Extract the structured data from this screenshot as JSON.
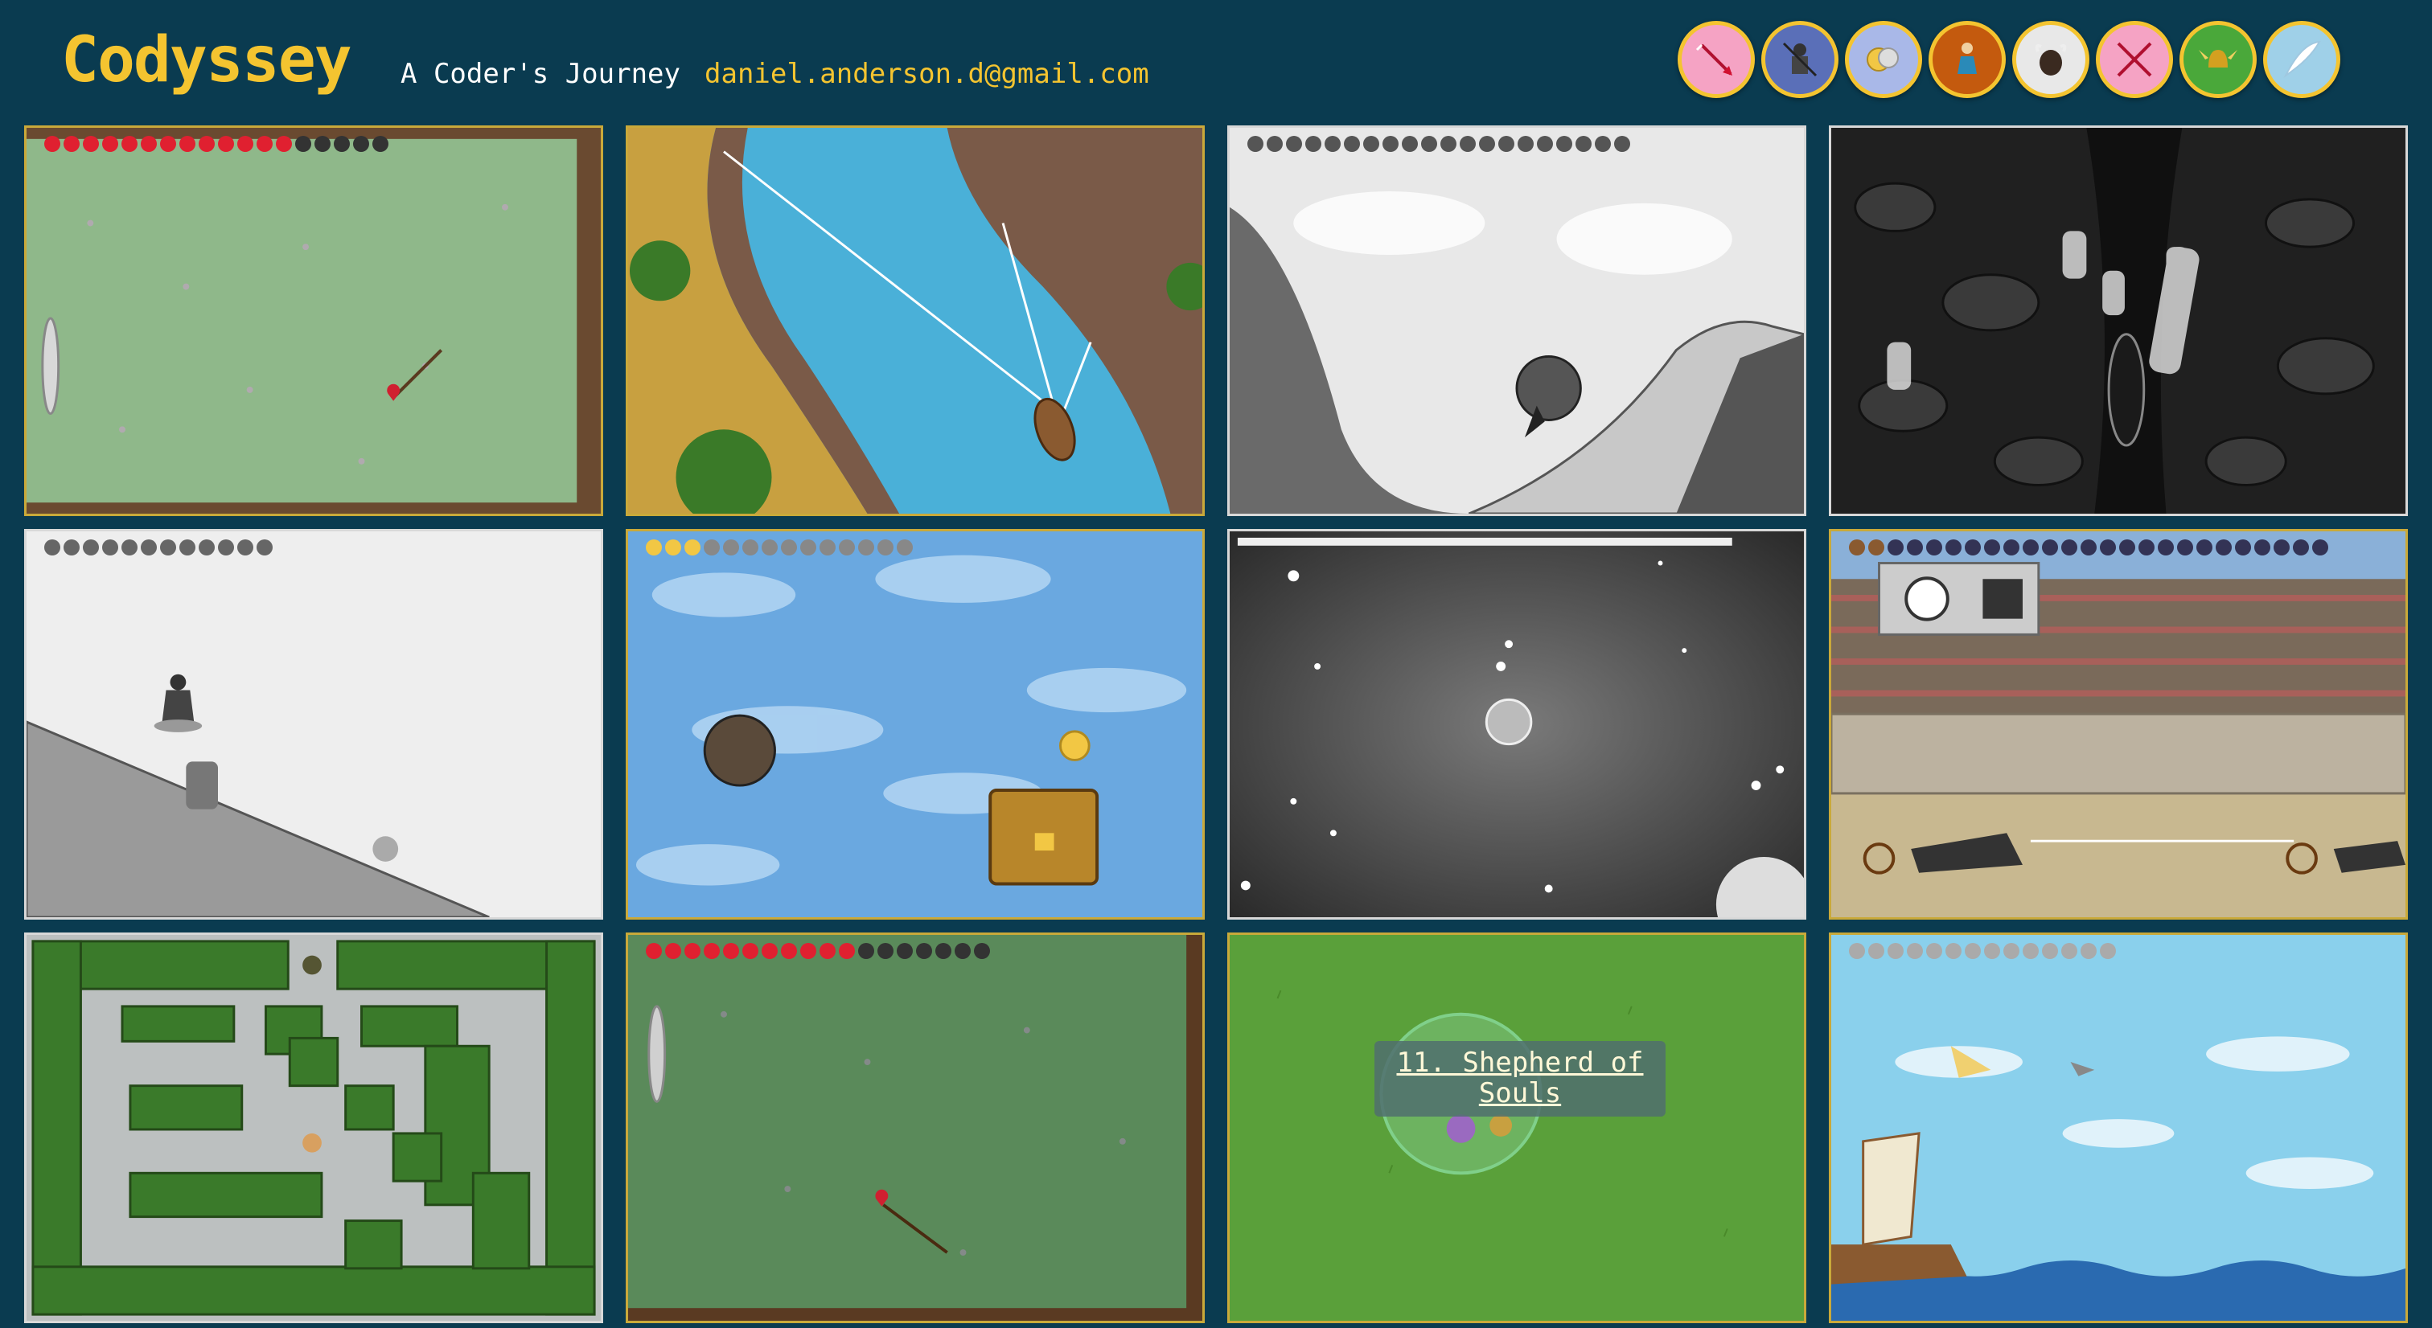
{
  "header": {
    "logo": "Codyssey",
    "subtitle": "A Coder's Journey",
    "email": "daniel.anderson.d@gmail.com"
  },
  "badges": [
    {
      "icon": "arrow-icon",
      "bg": "#f5a3c4"
    },
    {
      "icon": "armored-warrior-icon",
      "bg": "#5a6fb8"
    },
    {
      "icon": "coins-icon",
      "bg": "#a9b8e8"
    },
    {
      "icon": "seated-figure-icon",
      "bg": "#c45a0e"
    },
    {
      "icon": "bull-icon",
      "bg": "#e8e8e8"
    },
    {
      "icon": "crossed-arrows-icon",
      "bg": "#f5a3c4"
    },
    {
      "icon": "winged-helmet-icon",
      "bg": "#4aa83a"
    },
    {
      "icon": "feather-wing-icon",
      "bg": "#9fd0e8"
    }
  ],
  "levels": [
    {
      "id": "level-1",
      "scene": "meadow-archery"
    },
    {
      "id": "level-2",
      "scene": "river-boat"
    },
    {
      "id": "level-3",
      "scene": "sisyphus-hill"
    },
    {
      "id": "level-4",
      "scene": "underworld-boat"
    },
    {
      "id": "level-5",
      "scene": "slope-runner"
    },
    {
      "id": "level-6",
      "scene": "sky-treasure"
    },
    {
      "id": "level-7",
      "scene": "starfield"
    },
    {
      "id": "level-8",
      "scene": "chariot-race"
    },
    {
      "id": "level-9",
      "scene": "hedge-maze"
    },
    {
      "id": "level-10",
      "scene": "meadow-archery-2"
    },
    {
      "id": "level-11",
      "scene": "shepherd-field",
      "tooltip": "11. Shepherd of Souls"
    },
    {
      "id": "level-12",
      "scene": "icarus-sea"
    }
  ]
}
